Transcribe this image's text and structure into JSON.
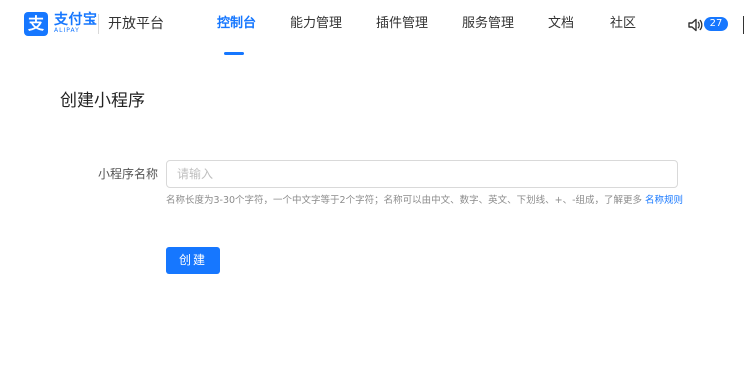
{
  "header": {
    "logo_mark": "支",
    "logo_cn": "支付宝",
    "logo_en": "ALIPAY",
    "platform_title": "开放平台",
    "nav": [
      {
        "label": "控制台",
        "active": true
      },
      {
        "label": "能力管理",
        "active": false
      },
      {
        "label": "插件管理",
        "active": false
      },
      {
        "label": "服务管理",
        "active": false
      },
      {
        "label": "文档",
        "active": false
      },
      {
        "label": "社区",
        "active": false
      }
    ],
    "notification_count": "27",
    "icons": {
      "speaker": "speaker-icon",
      "partial_right": "menu-icon"
    },
    "accent_color": "#1677ff"
  },
  "page": {
    "title": "创建小程序"
  },
  "form": {
    "name_label": "小程序名称",
    "name_placeholder": "请输入",
    "name_value": "",
    "hint_text": "名称长度为3-30个字符，一个中文字等于2个字符；名称可以由中文、数字、英文、下划线、+、-组成，了解更多",
    "hint_link": "名称规则",
    "submit_label": "创建"
  }
}
